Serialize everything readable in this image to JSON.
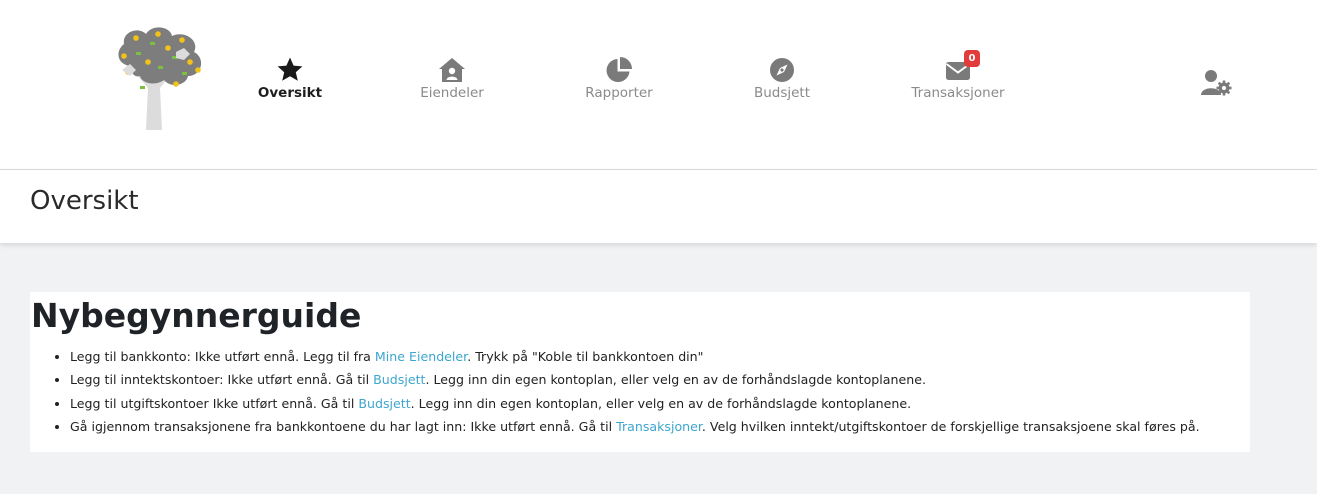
{
  "nav": {
    "items": [
      {
        "label": "Oversikt",
        "icon": "star-icon",
        "active": true
      },
      {
        "label": "Eiendeler",
        "icon": "house-user-icon",
        "active": false
      },
      {
        "label": "Rapporter",
        "icon": "pie-chart-icon",
        "active": false
      },
      {
        "label": "Budsjett",
        "icon": "compass-icon",
        "active": false
      },
      {
        "label": "Transaksjoner",
        "icon": "envelope-icon",
        "active": false,
        "badge": "0"
      }
    ],
    "user_icon": "user-cog-icon"
  },
  "page": {
    "title": "Oversikt"
  },
  "guide": {
    "title": "Nybegynnerguide",
    "items": [
      {
        "before": "Legg til bankkonto: Ikke utført ennå. Legg til fra ",
        "link": "Mine Eiendeler",
        "after": ". Trykk på \"Koble til bankkontoen din\""
      },
      {
        "before": "Legg til inntektskontoer: Ikke utført ennå. Gå til ",
        "link": "Budsjett",
        "after": ". Legg inn din egen kontoplan, eller velg en av de forhåndslagde kontoplanene."
      },
      {
        "before": "Legg til utgiftskontoer Ikke utført ennå. Gå til ",
        "link": "Budsjett",
        "after": ". Legg inn din egen kontoplan, eller velg en av de forhåndslagde kontoplanene."
      },
      {
        "before": "Gå igjennom transaksjonene fra bankkontoene du har lagt inn: Ikke utført ennå. Gå til ",
        "link": "Transaksjoner",
        "after": ". Velg hvilken inntekt/utgiftskontoer de forskjellige transaksjoene skal føres på."
      }
    ]
  },
  "colors": {
    "accent_link": "#3ea6cf",
    "badge": "#e23b3b",
    "icon_gray": "#7a7a7a",
    "background": "#f1f2f4"
  }
}
